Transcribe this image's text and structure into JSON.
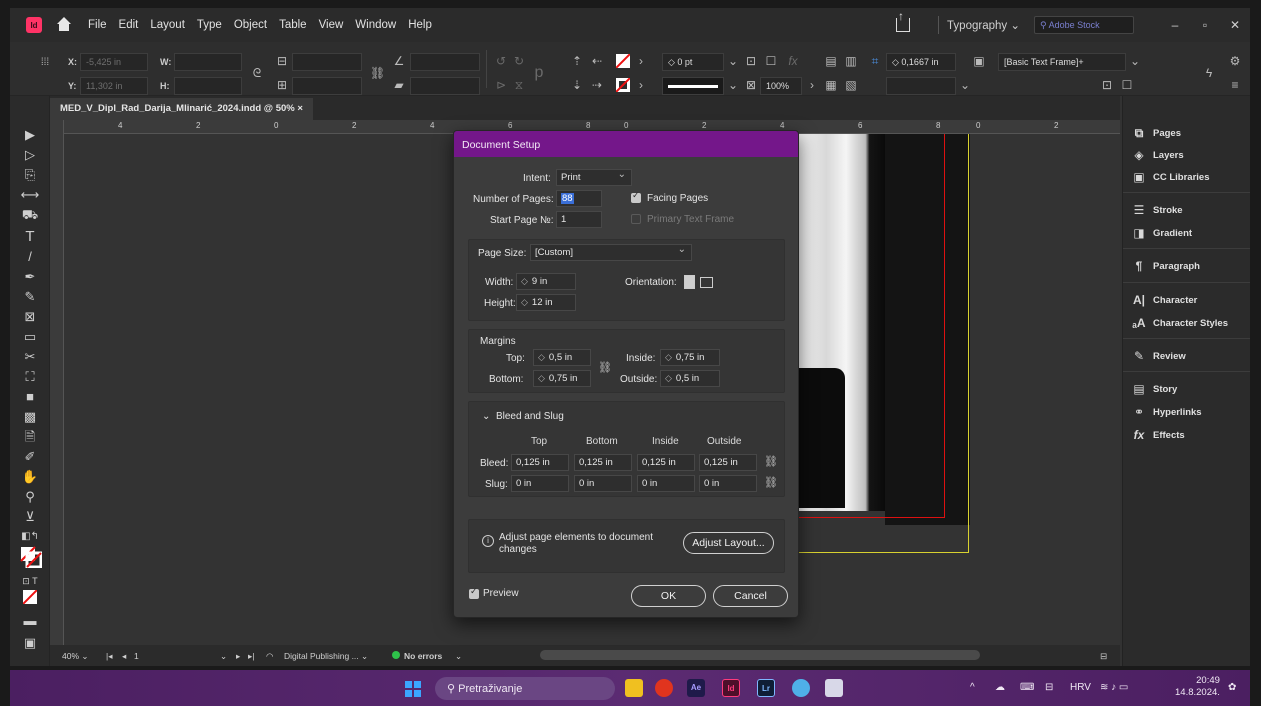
{
  "app": {
    "logo": "Id",
    "colors": {
      "accent": "#74178a",
      "taskbar": "#4b1f61",
      "guide_red": "#dd1111",
      "guide_blue": "#4a42d8",
      "guide_yellow": "#d8d230",
      "ok_green": "#2ec04a"
    }
  },
  "menu": [
    "File",
    "Edit",
    "Layout",
    "Type",
    "Object",
    "Table",
    "View",
    "Window",
    "Help"
  ],
  "header": {
    "workspace": "Typography",
    "search_placeholder": "Adobe Stock"
  },
  "controlbar": {
    "x_label": "X:",
    "y_label": "Y:",
    "w_label": "W:",
    "h_label": "H:",
    "x_value": "-5,425 in",
    "y_value": "11,302 in",
    "stroke_weight": "0 pt",
    "zoom_percent": "100%",
    "gutter": "0,1667 in",
    "object_style": "[Basic Text Frame]+"
  },
  "document": {
    "tab_title": "MED_V_Dipl_Rad_Darija_Mlinarić_2024.indd @ 50%"
  },
  "ruler": {
    "h_ticks": [
      "4",
      "2",
      "0",
      "2",
      "4",
      "6",
      "8",
      "0",
      "2",
      "4",
      "6",
      "8",
      "0",
      "2"
    ]
  },
  "statusbar": {
    "zoom": "40%",
    "page": "1",
    "profile": "Digital Publishing ...",
    "preflight": "No errors"
  },
  "panels": [
    {
      "label": "Pages",
      "icon": "pages-icon"
    },
    {
      "label": "Layers",
      "icon": "layers-icon"
    },
    {
      "label": "CC Libraries",
      "icon": "cc-libraries-icon"
    },
    {
      "label": "Stroke",
      "icon": "stroke-icon"
    },
    {
      "label": "Gradient",
      "icon": "gradient-icon"
    },
    {
      "label": "Paragraph",
      "icon": "paragraph-icon"
    },
    {
      "label": "Character",
      "icon": "character-icon"
    },
    {
      "label": "Character Styles",
      "icon": "character-styles-icon"
    },
    {
      "label": "Review",
      "icon": "review-icon"
    },
    {
      "label": "Story",
      "icon": "story-icon"
    },
    {
      "label": "Hyperlinks",
      "icon": "hyperlinks-icon"
    },
    {
      "label": "Effects",
      "icon": "effects-icon"
    }
  ],
  "dialog": {
    "title": "Document Setup",
    "intent_label": "Intent:",
    "intent_value": "Print",
    "pages_label": "Number of Pages:",
    "pages_value": "88",
    "start_label": "Start Page №:",
    "start_value": "1",
    "facing_label": "Facing Pages",
    "facing_checked": true,
    "primary_label": "Primary Text Frame",
    "primary_checked": false,
    "page_size_label": "Page Size:",
    "page_size_value": "[Custom]",
    "width_label": "Width:",
    "width_value": "9 in",
    "height_label": "Height:",
    "height_value": "12 in",
    "orientation_label": "Orientation:",
    "margins_title": "Margins",
    "top_label": "Top:",
    "top_value": "0,5 in",
    "bottom_label": "Bottom:",
    "bottom_value": "0,75 in",
    "inside_label": "Inside:",
    "inside_value": "0,75 in",
    "outside_label": "Outside:",
    "outside_value": "0,5 in",
    "bleed_slug_title": "Bleed and Slug",
    "col_top": "Top",
    "col_bottom": "Bottom",
    "col_inside": "Inside",
    "col_outside": "Outside",
    "bleed_label": "Bleed:",
    "bleed_values": [
      "0,125 in",
      "0,125 in",
      "0,125 in",
      "0,125 in"
    ],
    "slug_label": "Slug:",
    "slug_values": [
      "0 in",
      "0 in",
      "0 in",
      "0 in"
    ],
    "adjust_text": "Adjust page elements to document changes",
    "adjust_button": "Adjust Layout...",
    "preview_label": "Preview",
    "preview_checked": true,
    "ok_button": "OK",
    "cancel_button": "Cancel"
  },
  "taskbar": {
    "search_text": "Pretraživanje",
    "language": "HRV",
    "time": "20:49",
    "date": "14.8.2024."
  }
}
